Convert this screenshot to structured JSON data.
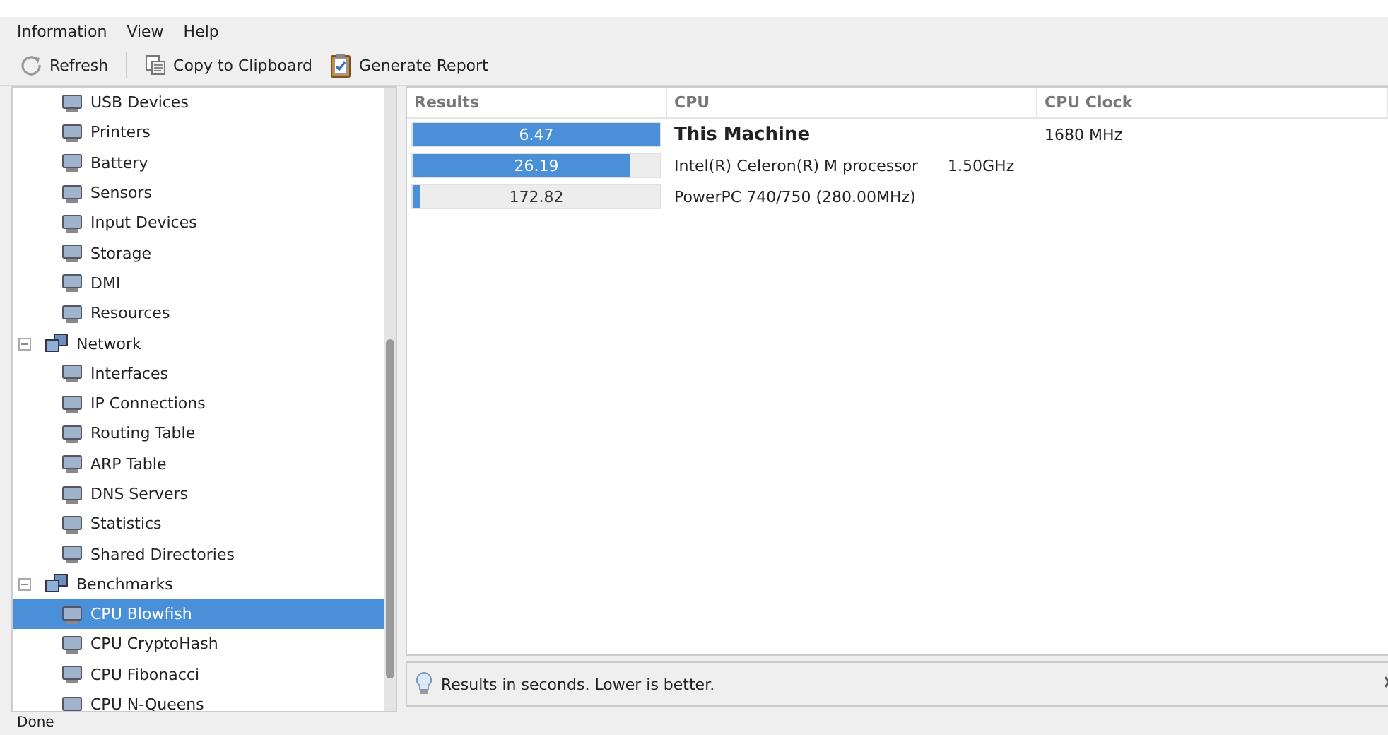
{
  "menu": [
    "Information",
    "View",
    "Help"
  ],
  "toolbar": [
    {
      "label": "Refresh",
      "kind": "refresh"
    },
    {
      "label": "Copy to Clipboard",
      "kind": "copy"
    },
    {
      "label": "Generate Report",
      "kind": "report"
    }
  ],
  "tree": {
    "continued_items": [
      {
        "label": "USB Devices",
        "selected": false
      },
      {
        "label": "Printers",
        "selected": false
      },
      {
        "label": "Battery",
        "selected": false
      },
      {
        "label": "Sensors",
        "selected": false
      },
      {
        "label": "Input Devices",
        "selected": false
      },
      {
        "label": "Storage",
        "selected": false
      },
      {
        "label": "DMI",
        "selected": false
      },
      {
        "label": "Resources",
        "selected": false
      }
    ],
    "groups": [
      {
        "label": "Network",
        "expanded": true,
        "selected": false,
        "children": [
          {
            "label": "Interfaces",
            "selected": false
          },
          {
            "label": "IP Connections",
            "selected": false
          },
          {
            "label": "Routing Table",
            "selected": false
          },
          {
            "label": "ARP Table",
            "selected": false
          },
          {
            "label": "DNS Servers",
            "selected": false
          },
          {
            "label": "Statistics",
            "selected": false
          },
          {
            "label": "Shared Directories",
            "selected": false
          }
        ]
      },
      {
        "label": "Benchmarks",
        "expanded": true,
        "selected": false,
        "children": [
          {
            "label": "CPU Blowfish",
            "selected": true
          },
          {
            "label": "CPU CryptoHash",
            "selected": false
          },
          {
            "label": "CPU Fibonacci",
            "selected": false
          },
          {
            "label": "CPU N-Queens",
            "selected": false
          }
        ]
      }
    ]
  },
  "table": {
    "columns": [
      "Results",
      "CPU",
      "CPU Clock"
    ],
    "rows": [
      {
        "result": "6.47",
        "level": 1.0,
        "cpu": "This Machine",
        "clock": "1680 MHz",
        "kind": "current"
      },
      {
        "result": "26.19",
        "level": 0.88,
        "cpu": "Intel(R) Celeron(R) M processor      1.50GHz",
        "kind": "reference"
      },
      {
        "result": "172.82",
        "level": 0.03,
        "cpu": "PowerPC 740/750 (280.00MHz)",
        "kind": "reference"
      }
    ]
  },
  "note": "Results in seconds. Lower is better.",
  "status_bar": "Done"
}
